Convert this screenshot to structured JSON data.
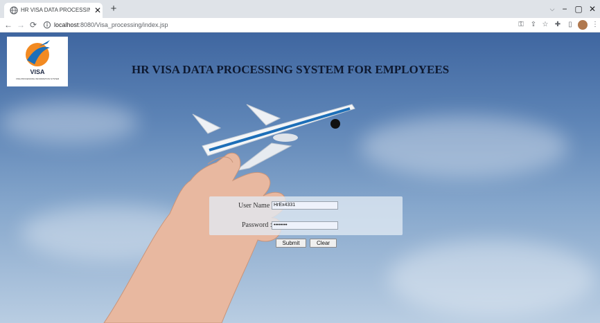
{
  "browser": {
    "tab_title": "HR VISA DATA PROCESSING SYS",
    "tab_close": "✕",
    "new_tab": "+",
    "url_host": "localhost",
    "url_path": ":8080/Visa_processing/index.jsp",
    "window_controls": {
      "tab_search": "⌵",
      "minimize": "−",
      "maximize": "▢",
      "close": "✕"
    },
    "toolbar_icons": [
      "key-icon",
      "share-icon",
      "star-icon",
      "extensions-icon",
      "sidepanel-icon",
      "profile-icon",
      "menu-icon"
    ]
  },
  "page": {
    "logo_text": "VISA",
    "logo_subtext": "VISA PROCESSING INFORMATION SYSTEM",
    "title": "HR VISA DATA PROCESSING SYSTEM FOR EMPLOYEES"
  },
  "login": {
    "username_label": "User Name :",
    "username_value": "HrEx4331",
    "password_label": "Password :",
    "password_value": "••••••••",
    "submit_label": "Submit",
    "clear_label": "Clear"
  },
  "colors": {
    "sky_top": "#3f66a0",
    "sky_bottom": "#b9cde2",
    "title_text": "#0e1930",
    "logo_orange": "#f28a22",
    "logo_blue": "#1d6fb8"
  }
}
